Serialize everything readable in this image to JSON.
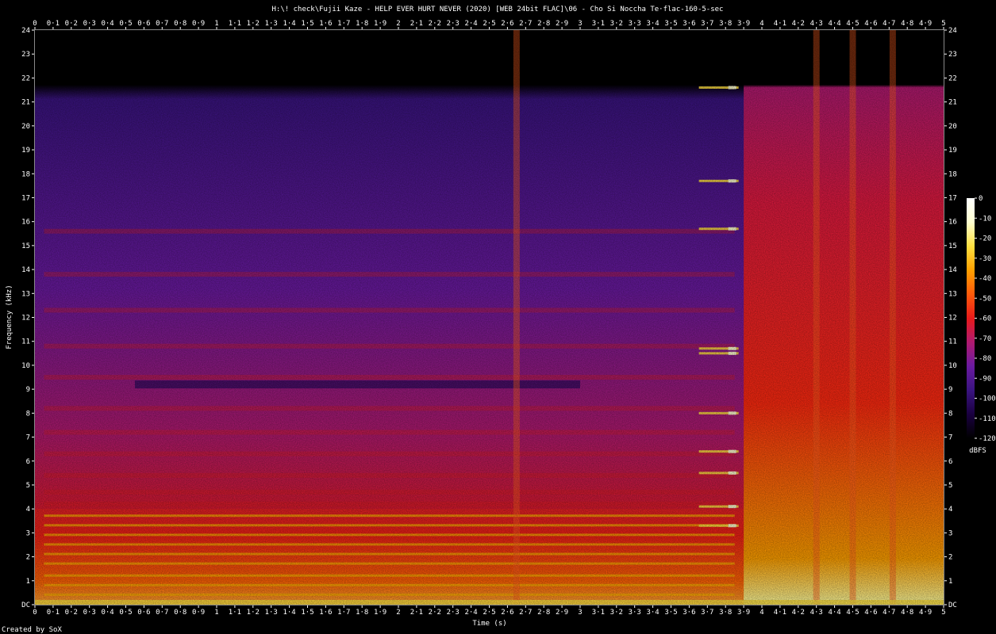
{
  "chart_data": {
    "type": "heatmap",
    "title": "H:\\! check\\Fujii Kaze - HELP EVER HURT NEVER (2020) [WEB 24bit FLAC]\\06 - Cho Si Noccha Te·flac-160-5-sec",
    "xlabel": "Time (s)",
    "ylabel": "Frequency (kHz)",
    "xlim": [
      0,
      5
    ],
    "ylim": [
      0,
      24
    ],
    "x_ticks": [
      "0",
      "0·1",
      "0·2",
      "0·3",
      "0·4",
      "0·5",
      "0·6",
      "0·7",
      "0·8",
      "0·9",
      "1",
      "1·1",
      "1·2",
      "1·3",
      "1·4",
      "1·5",
      "1·6",
      "1·7",
      "1·8",
      "1·9",
      "2",
      "2·1",
      "2·2",
      "2·3",
      "2·4",
      "2·5",
      "2·6",
      "2·7",
      "2·8",
      "2·9",
      "3",
      "3·1",
      "3·2",
      "3·3",
      "3·4",
      "3·5",
      "3·6",
      "3·7",
      "3·8",
      "3·9",
      "4",
      "4·1",
      "4·2",
      "4·3",
      "4·4",
      "4·5",
      "4·6",
      "4·7",
      "4·8",
      "4·9",
      "5"
    ],
    "y_ticks": [
      "DC",
      "1",
      "2",
      "3",
      "4",
      "5",
      "6",
      "7",
      "8",
      "9",
      "10",
      "11",
      "12",
      "13",
      "14",
      "15",
      "16",
      "17",
      "18",
      "19",
      "20",
      "21",
      "22",
      "23",
      "24"
    ],
    "colorbar": {
      "unit": "dBFS",
      "ticks": [
        "0",
        "-10",
        "-20",
        "-30",
        "-40",
        "-50",
        "-60",
        "-70",
        "-80",
        "-90",
        "-100",
        "-110",
        "-120"
      ],
      "range": [
        -120,
        0
      ]
    },
    "footer": "Created by SoX",
    "lowpass_cutoff_khz": 22,
    "tonal_spikes_khz": [
      21.6,
      17.7,
      15.7,
      10.7,
      10.5,
      8.0,
      6.4,
      5.5,
      4.1,
      3.3
    ],
    "spike_time_s": 3.85,
    "horizontal_bands_khz": [
      0.4,
      0.8,
      1.2,
      1.7,
      2.1,
      2.5,
      2.9,
      3.3,
      3.7,
      4.2,
      4.7,
      5.4,
      6.3,
      7.2,
      8.2,
      9.5,
      10.8,
      12.3,
      13.8,
      15.6
    ],
    "dark_band_khz": 9.2,
    "loud_segment_time_s": [
      3.9,
      5.0
    ],
    "transient_times_s": [
      2.65,
      4.3,
      4.5,
      4.72
    ],
    "colors": {
      "scale": [
        "#000000",
        "#1a0040",
        "#3a1480",
        "#6a1aa0",
        "#b01a70",
        "#e81a1a",
        "#ff5a0a",
        "#ffa000",
        "#ffe040",
        "#ffffd0",
        "#ffffff"
      ],
      "text": "#ffffff",
      "background": "#000000"
    }
  }
}
